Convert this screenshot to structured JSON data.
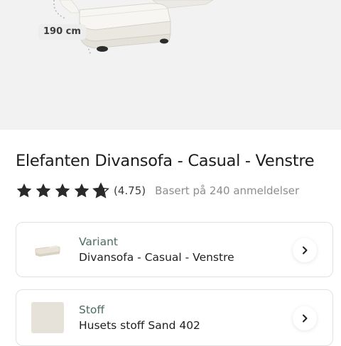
{
  "hero": {
    "dimension_label": "190 cm"
  },
  "product": {
    "title": "Elefanten Divansofa - Casual - Venstre",
    "rating_value": "(4.75)",
    "review_text": "Basert på 240 anmeldelser",
    "rating": 4.75,
    "rating_max": 5,
    "star_color": "#2a2a2a"
  },
  "options": {
    "variant": {
      "label": "Variant",
      "value": "Divansofa - Casual - Venstre",
      "icon": "sofa-thumbnail"
    },
    "fabric": {
      "label": "Stoff",
      "value": "Husets stoff Sand 402",
      "icon": "fabric-swatch"
    }
  }
}
